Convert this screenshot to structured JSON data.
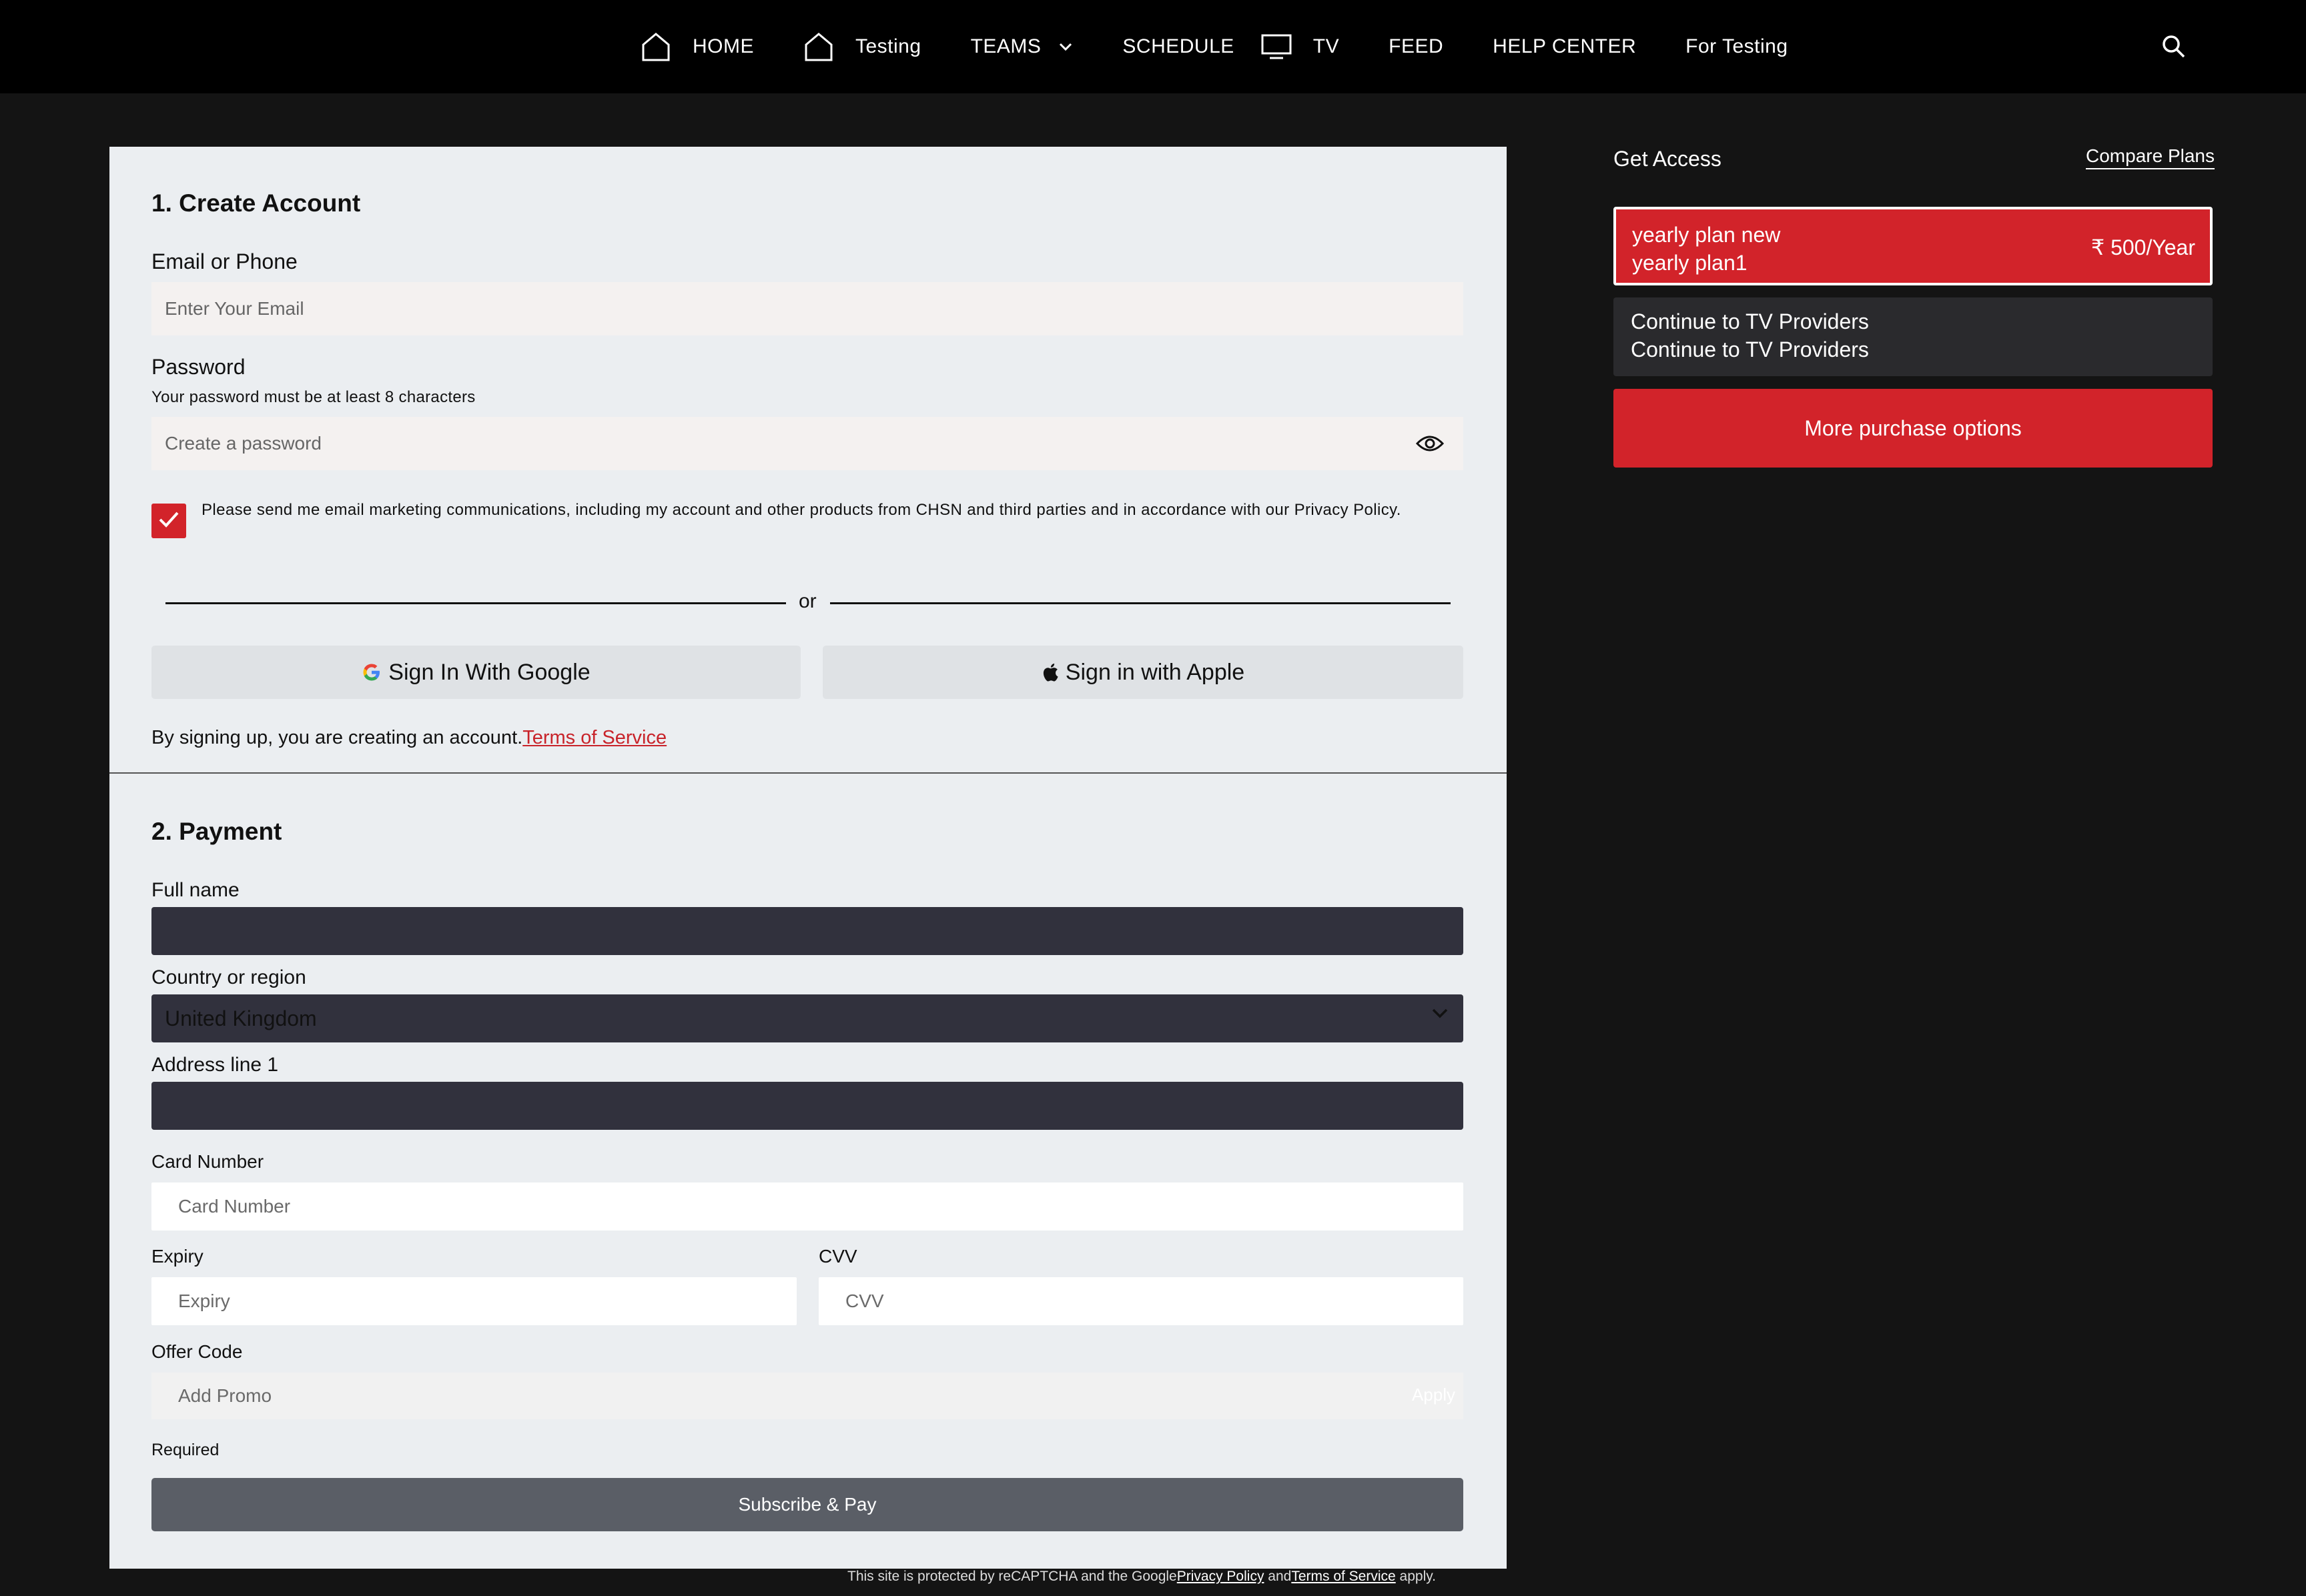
{
  "nav": {
    "items": [
      {
        "label": "HOME",
        "icon": "home-icon"
      },
      {
        "label": "Testing",
        "icon": "home-icon"
      },
      {
        "label": "TEAMS",
        "icon": "chevron-down-icon"
      },
      {
        "label": "SCHEDULE"
      },
      {
        "label": "TV",
        "icon": "tv-icon"
      },
      {
        "label": "FEED"
      },
      {
        "label": "HELP CENTER"
      },
      {
        "label": "For Testing"
      }
    ],
    "search_icon": "search-icon"
  },
  "create_account": {
    "title": "1. Create Account",
    "email_label": "Email or Phone",
    "email_placeholder": "Enter Your Email",
    "password_label": "Password",
    "password_hint": "Your password must be at least 8 characters",
    "password_placeholder": "Create a password",
    "consent_text": "Please send me email marketing communications, including my account and other products from CHSN and third parties and in accordance with our Privacy Policy.",
    "consent_checked": true,
    "or_text": "or",
    "google_button": "Sign In With Google",
    "apple_button": "Sign in with Apple",
    "signup_note": "By signing up, you are creating an account.",
    "terms_link": "Terms of Service"
  },
  "payment": {
    "title": "2. Payment",
    "full_name_label": "Full name",
    "full_name_value": "",
    "country_label": "Country or region",
    "country_value": "United Kingdom",
    "address_label": "Address line 1",
    "address_value": "",
    "card_label": "Card Number",
    "card_placeholder": "Card Number",
    "expiry_label": "Expiry",
    "expiry_placeholder": "Expiry",
    "cvv_label": "CVV",
    "cvv_placeholder": "CVV",
    "offer_label": "Offer Code",
    "offer_placeholder": "Add Promo",
    "apply_button": "Apply",
    "required_text": "Required",
    "subscribe_button": "Subscribe & Pay"
  },
  "footer": {
    "recaptcha_prefix": "This site is protected by reCAPTCHA and the Google",
    "privacy_link": "Privacy Policy",
    "and_text": " and",
    "terms_link": "Terms of Service",
    "suffix": " apply."
  },
  "access": {
    "title": "Get Access",
    "compare_link": "Compare Plans",
    "plan": {
      "name_line1": "yearly plan new",
      "name_line2": "yearly plan1",
      "price": "₹ 500/Year"
    },
    "tv_provider": {
      "line1": "Continue to TV Providers",
      "line2": "Continue to TV Providers"
    },
    "more_button": "More purchase options"
  },
  "colors": {
    "accent": "#d2232a",
    "nav_bg": "#000000",
    "page_bg": "#141414",
    "panel_bg": "#ebeef1",
    "dark_field": "#31313d"
  }
}
